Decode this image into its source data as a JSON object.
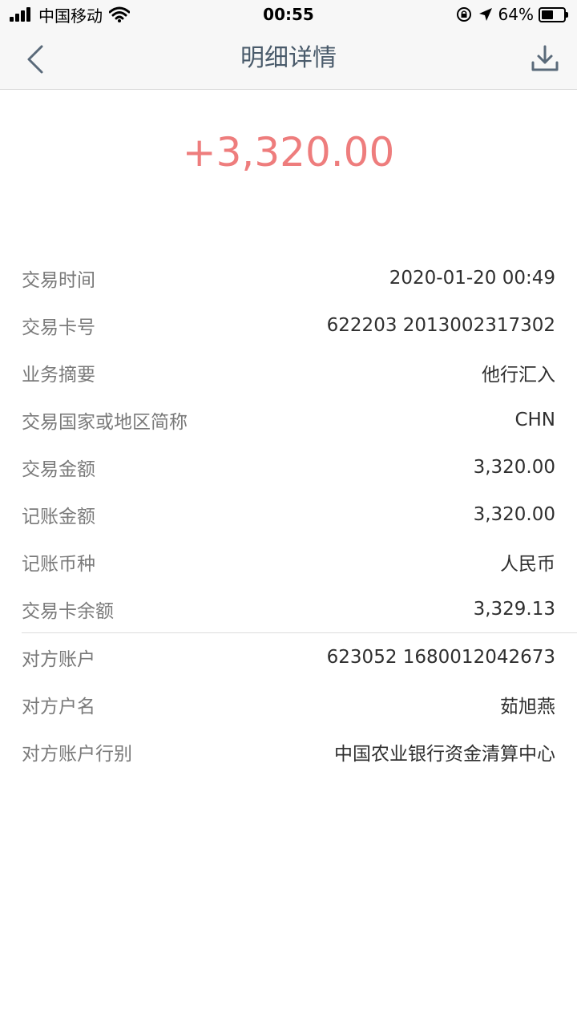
{
  "status_bar": {
    "carrier": "中国移动",
    "time": "00:55",
    "battery": "64%",
    "battery_level": 0.64
  },
  "nav": {
    "title": "明细详情"
  },
  "amount": "+3,320.00",
  "details": [
    {
      "label": "交易时间",
      "value": "2020-01-20 00:49"
    },
    {
      "label": "交易卡号",
      "value": "622203 2013002317302"
    },
    {
      "label": "业务摘要",
      "value": "他行汇入"
    },
    {
      "label": "交易国家或地区简称",
      "value": "CHN"
    },
    {
      "label": "交易金额",
      "value": "3,320.00"
    },
    {
      "label": "记账金额",
      "value": "3,320.00"
    },
    {
      "label": "记账币种",
      "value": "人民币"
    },
    {
      "label": "交易卡余额",
      "value": "3,329.13"
    }
  ],
  "counterparty": [
    {
      "label": "对方账户",
      "value": "623052 1680012042673"
    },
    {
      "label": "对方户名",
      "value": "茹旭燕"
    },
    {
      "label": "对方账户行别",
      "value": "中国农业银行资金清算中心"
    }
  ],
  "colors": {
    "amount": "#ee7d7d",
    "title": "#4a5b6b",
    "label": "#7a7a7a",
    "value": "#2f2f2f"
  }
}
